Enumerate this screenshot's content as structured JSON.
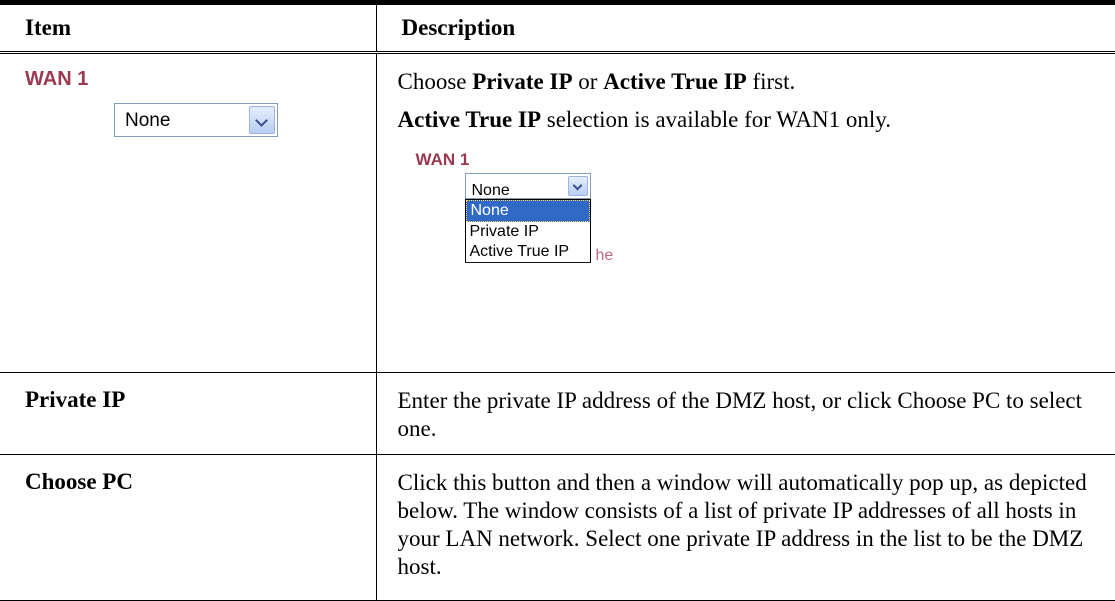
{
  "table": {
    "header": {
      "item": "Item",
      "description": "Description"
    },
    "row_wan": {
      "label": "WAN 1",
      "select_value": "None",
      "desc_line1_pre": "Choose ",
      "desc_line1_b1": "Private IP",
      "desc_line1_mid": " or ",
      "desc_line1_b2": "Active True IP",
      "desc_line1_post": " first.",
      "desc_line2_b": "Active True IP",
      "desc_line2_post": " selection is available for WAN1 only.",
      "screenshot": {
        "label": "WAN 1",
        "select_value": "None",
        "options": [
          "None",
          "Private IP",
          "Active True IP"
        ],
        "ghost_text": "he"
      }
    },
    "row_private": {
      "label": "Private IP",
      "desc": "Enter the private IP address of the DMZ host, or click Choose PC to select one."
    },
    "row_choose": {
      "label": "Choose PC",
      "desc": "Click this button and then a window will automatically pop up, as depicted below. The window consists of a list of private IP addresses of all hosts in your LAN network. Select one private IP address in the list to be the DMZ host."
    }
  }
}
